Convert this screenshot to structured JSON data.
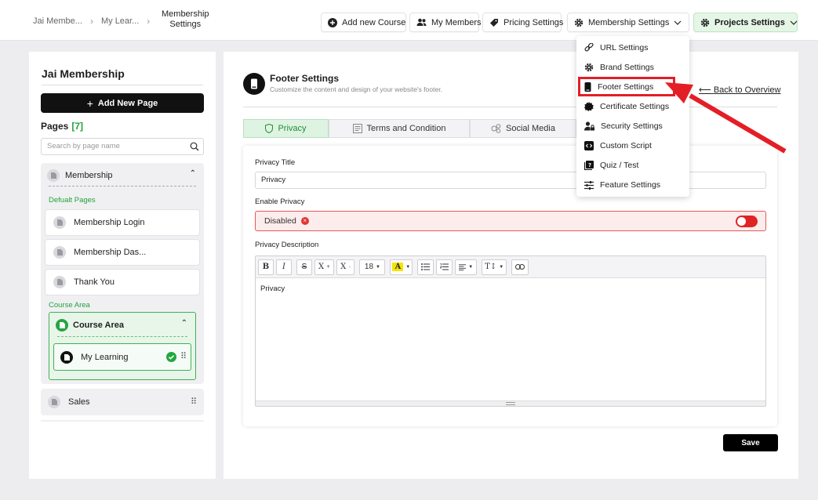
{
  "breadcrumb": {
    "items": [
      "Jai Membe...",
      "My Lear...",
      "Membership Settings"
    ]
  },
  "topnav": {
    "add_course": "Add new Course",
    "my_members": "My Members",
    "pricing": "Pricing Settings",
    "membership_settings": "Membership Settings",
    "projects_settings": "Projects Settings"
  },
  "sidebar": {
    "title": "Jai Membership",
    "new_page": "Add New Page",
    "pages_label": "Pages",
    "pages_count": "[7]",
    "search_placeholder": "Search by page name",
    "group_title": "Membership",
    "default_pages_label": "Defualt Pages",
    "default_pages": [
      "Membership Login",
      "Membership Das...",
      "Thank You"
    ],
    "course_area_label": "Course Area",
    "course_area_title": "Course Area",
    "course_item": "My Learning",
    "sales": "Sales"
  },
  "main": {
    "title": "Footer Settings",
    "subtitle": "Customize the content and design of your website's footer.",
    "back": "Back to Overview",
    "tabs": [
      "Privacy",
      "Terms and Condition",
      "Social Media"
    ],
    "privacy_title_label": "Privacy Title",
    "privacy_title_value": "Privacy",
    "enable_label": "Enable Privacy",
    "enable_status": "Disabled",
    "desc_label": "Privacy Description",
    "font_size": "18",
    "editor_text": "Privacy",
    "save": "Save"
  },
  "dropdown": {
    "items": [
      "URL Settings",
      "Brand Settings",
      "Footer Settings",
      "Certificate Settings",
      "Security Settings",
      "Custom Script",
      "Quiz / Test",
      "Feature Settings"
    ],
    "highlighted": "Footer Settings"
  },
  "colors": {
    "accent_green": "#22a33a",
    "highlight_red": "#e41e26",
    "toggle_off": "#e02424"
  }
}
